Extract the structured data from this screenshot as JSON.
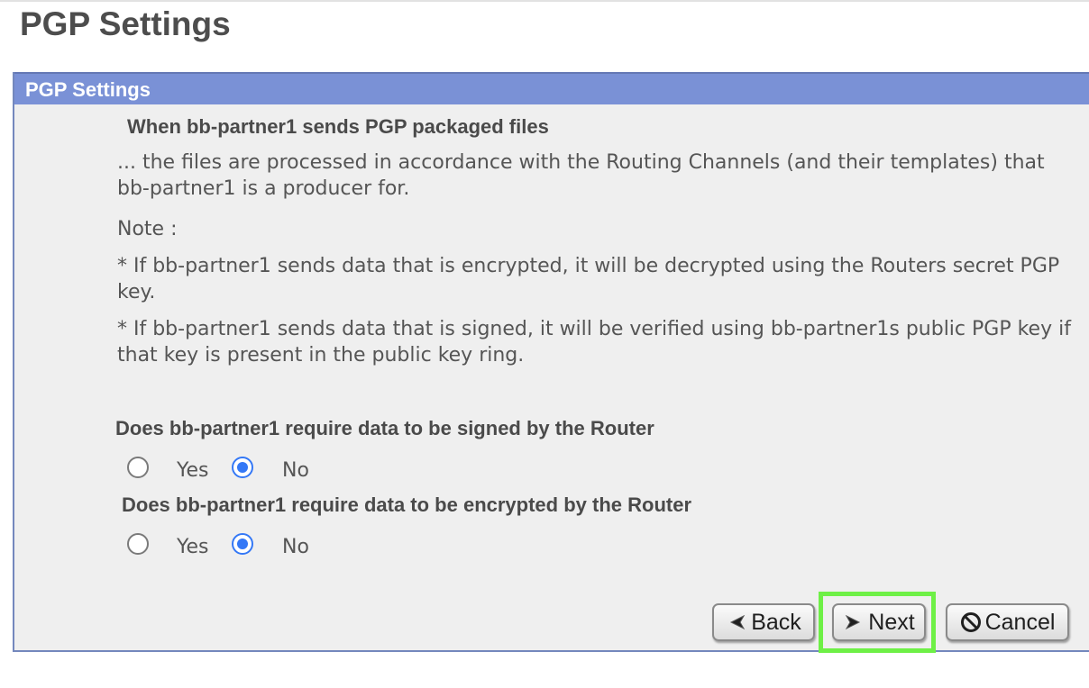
{
  "page": {
    "title": "PGP Settings"
  },
  "panel": {
    "header": "PGP Settings",
    "heading": "When bb-partner1 sends PGP packaged files",
    "description": "... the files are processed in accordance with the Routing Channels (and their templates) that bb-partner1 is a producer for.",
    "note_label": "Note :",
    "note_encrypted": "*  If bb-partner1 sends data that is encrypted, it will be decrypted using the Routers secret PGP key.",
    "note_signed": "*  If bb-partner1 sends data that is signed, it will be verified using bb-partner1s public PGP key if that key is present in the public key ring."
  },
  "questions": {
    "signed": {
      "label": "Does bb-partner1 require data to be signed by the Router",
      "yes_label": "Yes",
      "no_label": "No",
      "selected": "No"
    },
    "encrypted": {
      "label": "Does bb-partner1 require data to be encrypted by the Router",
      "yes_label": "Yes",
      "no_label": "No",
      "selected": "No"
    }
  },
  "buttons": {
    "back": "Back",
    "next": "Next",
    "cancel": "Cancel"
  },
  "icons": {
    "back": "back-arrow-icon",
    "next": "next-arrow-icon",
    "cancel": "cancel-icon"
  },
  "colors": {
    "header_bar": "#7a91d6",
    "panel_background": "#efefef",
    "radio_selected": "#3478f6",
    "highlight": "#6ef046"
  }
}
